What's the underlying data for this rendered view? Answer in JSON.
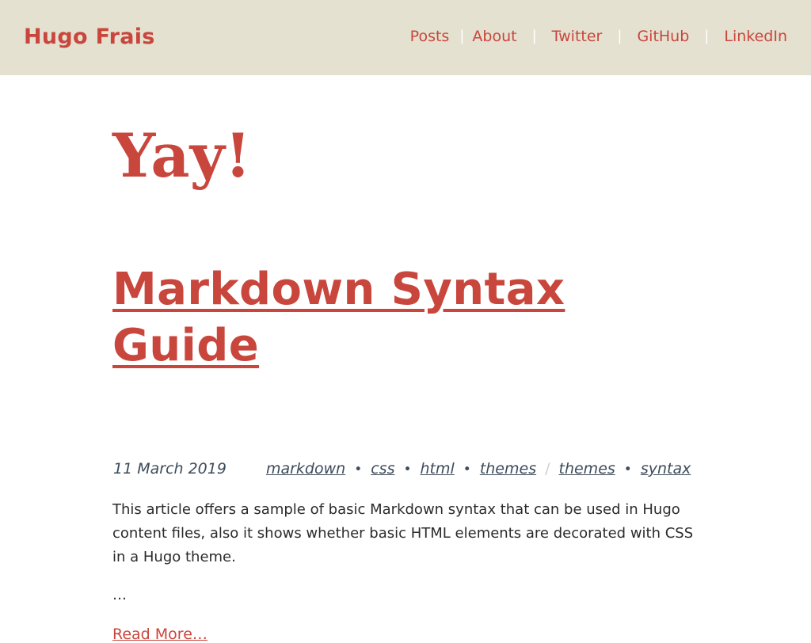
{
  "site": {
    "brand": "Hugo Frais"
  },
  "nav": {
    "items": [
      "Posts",
      "About",
      "Twitter",
      "GitHub",
      "LinkedIn"
    ],
    "separator": "|"
  },
  "page": {
    "heading": "Yay!"
  },
  "post": {
    "title": "Markdown Syntax Guide",
    "date": "11 March 2019",
    "categories": [
      "markdown",
      "css",
      "html",
      "themes"
    ],
    "tags": [
      "themes",
      "syntax"
    ],
    "summary": "This article offers a sample of basic Markdown syntax that can be used in Hugo content files, also it shows whether basic HTML elements are decorated with CSS in a Hugo theme.",
    "ellipsis": "…",
    "read_more": "Read More…"
  },
  "colors": {
    "accent": "#c9463d",
    "header_bg": "#e4e1d0",
    "meta": "#3d4b5b"
  }
}
